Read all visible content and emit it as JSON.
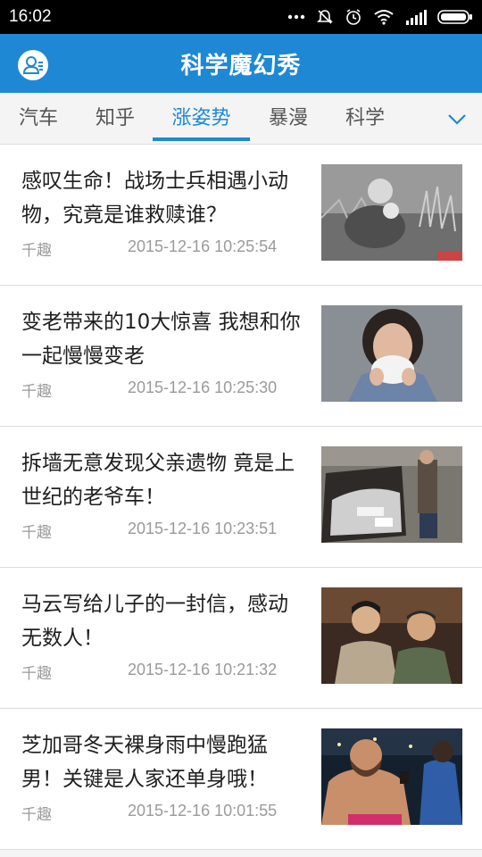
{
  "status_bar": {
    "time": "16:02",
    "icons": [
      "more-dots-icon",
      "mute-icon",
      "alarm-icon",
      "wifi-icon",
      "signal-icon",
      "battery-icon"
    ]
  },
  "header": {
    "title": "科学魔幻秀",
    "profile_icon": "user-profile-icon",
    "background_color": "#1e88d4"
  },
  "tabs": {
    "items": [
      {
        "label": "汽车",
        "active": false
      },
      {
        "label": "知乎",
        "active": false
      },
      {
        "label": "涨姿势",
        "active": true
      },
      {
        "label": "暴漫",
        "active": false
      },
      {
        "label": "科学",
        "active": false
      }
    ],
    "more_icon": "chevron-down-icon",
    "active_color": "#1e88d4"
  },
  "news": [
    {
      "title": "感叹生命！战场士兵相遇小动物，究竟是谁救赎谁？",
      "source": "千趣",
      "time": "2015-12-16 10:25:54",
      "thumb": "soldier-with-kitten-photo"
    },
    {
      "title": "变老带来的10大惊喜 我想和你一起慢慢变老",
      "source": "千趣",
      "time": "2015-12-16 10:25:30",
      "thumb": "woman-with-tissue-photo"
    },
    {
      "title": "拆墙无意发现父亲遗物 竟是上世纪的老爷车！",
      "source": "千趣",
      "time": "2015-12-16 10:23:51",
      "thumb": "old-car-in-wall-photo"
    },
    {
      "title": "马云写给儿子的一封信，感动无数人！",
      "source": "千趣",
      "time": "2015-12-16 10:21:32",
      "thumb": "two-men-portrait-photo"
    },
    {
      "title": "芝加哥冬天裸身雨中慢跑猛男！关键是人家还单身哦！",
      "source": "千趣",
      "time": "2015-12-16 10:01:55",
      "thumb": "shirtless-runner-interview-photo"
    }
  ]
}
